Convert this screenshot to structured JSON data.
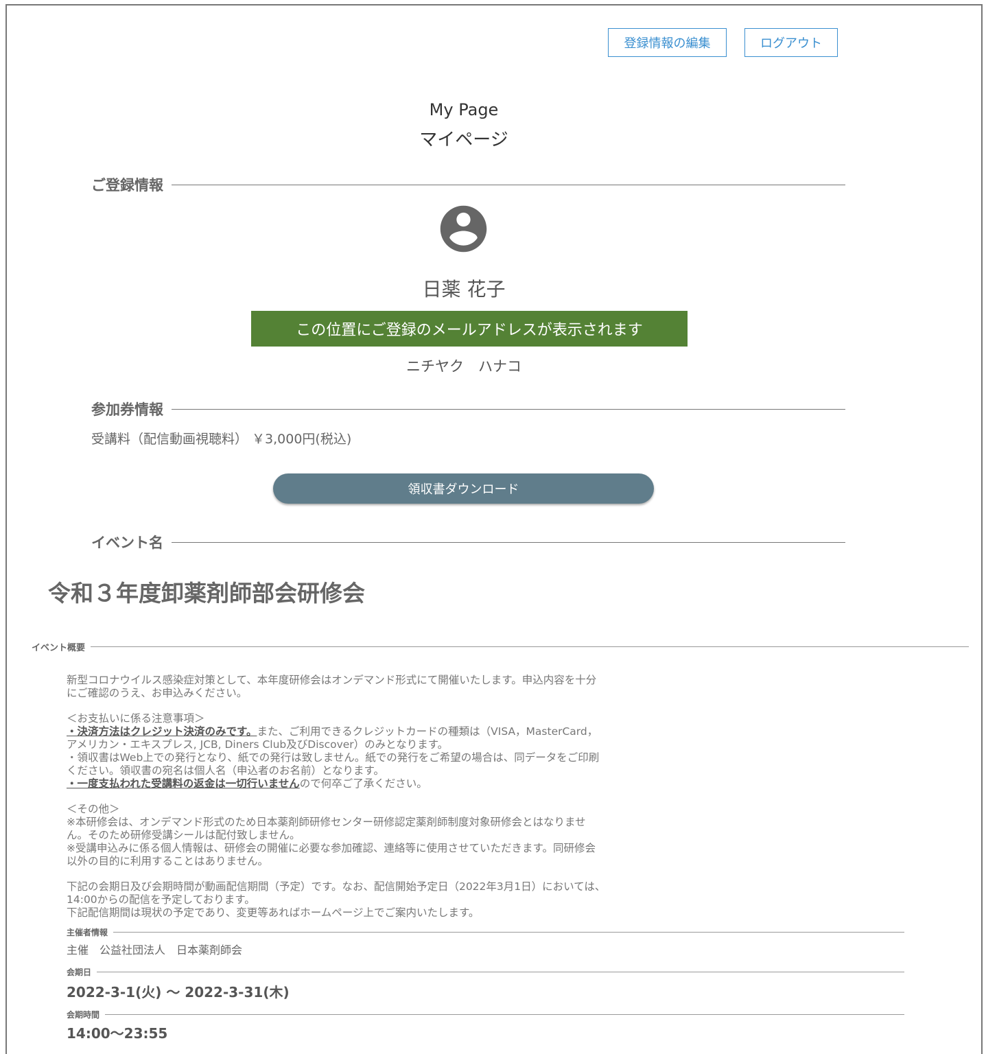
{
  "header": {
    "edit_label": "登録情報の編集",
    "logout_label": "ログアウト"
  },
  "page": {
    "title_en": "My Page",
    "title_ja": "マイページ"
  },
  "registration": {
    "heading": "ご登録情報",
    "name": "日薬 花子",
    "email_notice": "この位置にご登録のメールアドレスが表示されます",
    "kana": "ニチヤク　ハナコ"
  },
  "ticket": {
    "heading": "参加券情報",
    "fee": "受講料（配信動画視聴料） ￥3,000円(税込)",
    "receipt_button": "領収書ダウンロード"
  },
  "event": {
    "heading": "イベント名",
    "title": "令和３年度卸薬剤師部会研修会",
    "overview_heading": "イベント概要",
    "intro_1": "新型コロナウイルス感染症対策として、本年度研修会はオンデマンド形式にて開催いたします。申込内容を十分",
    "intro_2": "にご確認のうえ、お申込みください。",
    "pay_heading": "＜お支払いに係る注意事項＞",
    "pay_1a": "・決済方法はクレジット決済のみです。",
    "pay_1b": "また、ご利用できるクレジットカードの種類は（VISA，MasterCard，",
    "pay_2": "アメリカン・エキスプレス, JCB, Diners Club及びDiscover）のみとなります。",
    "pay_3": "・領収書はWeb上での発行となり、紙での発行は致しません。紙での発行をご希望の場合は、同データをご印刷",
    "pay_4": "ください。領収書の宛名は個人名（申込者のお名前）となります。",
    "pay_5a": "・一度支払われた受講料の返金は一切行いません",
    "pay_5b": "ので何卒ご了承ください。",
    "other_heading": "＜その他＞",
    "other_1": "※本研修会は、オンデマンド形式のため日本薬剤師研修センター研修認定薬剤師制度対象研修会とはなりませ",
    "other_2": "ん。そのため研修受講シールは配付致しません。",
    "other_3": "※受講申込みに係る個人情報は、研修会の開催に必要な参加確認、連絡等に使用させていただきます。同研修会",
    "other_4": "以外の目的に利用することはありません。",
    "period_1": "下記の会期日及び会期時間が動画配信期間（予定）です。なお、配信開始予定日（2022年3月1日）においては、",
    "period_2": "14:00からの配信を予定しております。",
    "period_3": "下記配信期間は現状の予定であり、変更等あればホームページ上でご案内いたします。",
    "organizer_heading": "主催者情報",
    "organizer": "主催　公益社団法人　日本薬剤師会",
    "date_heading": "会期日",
    "date": "2022-3-1(火) ～ 2022-3-31(木)",
    "time_heading": "会期時間",
    "time": "14:00～23:55"
  }
}
